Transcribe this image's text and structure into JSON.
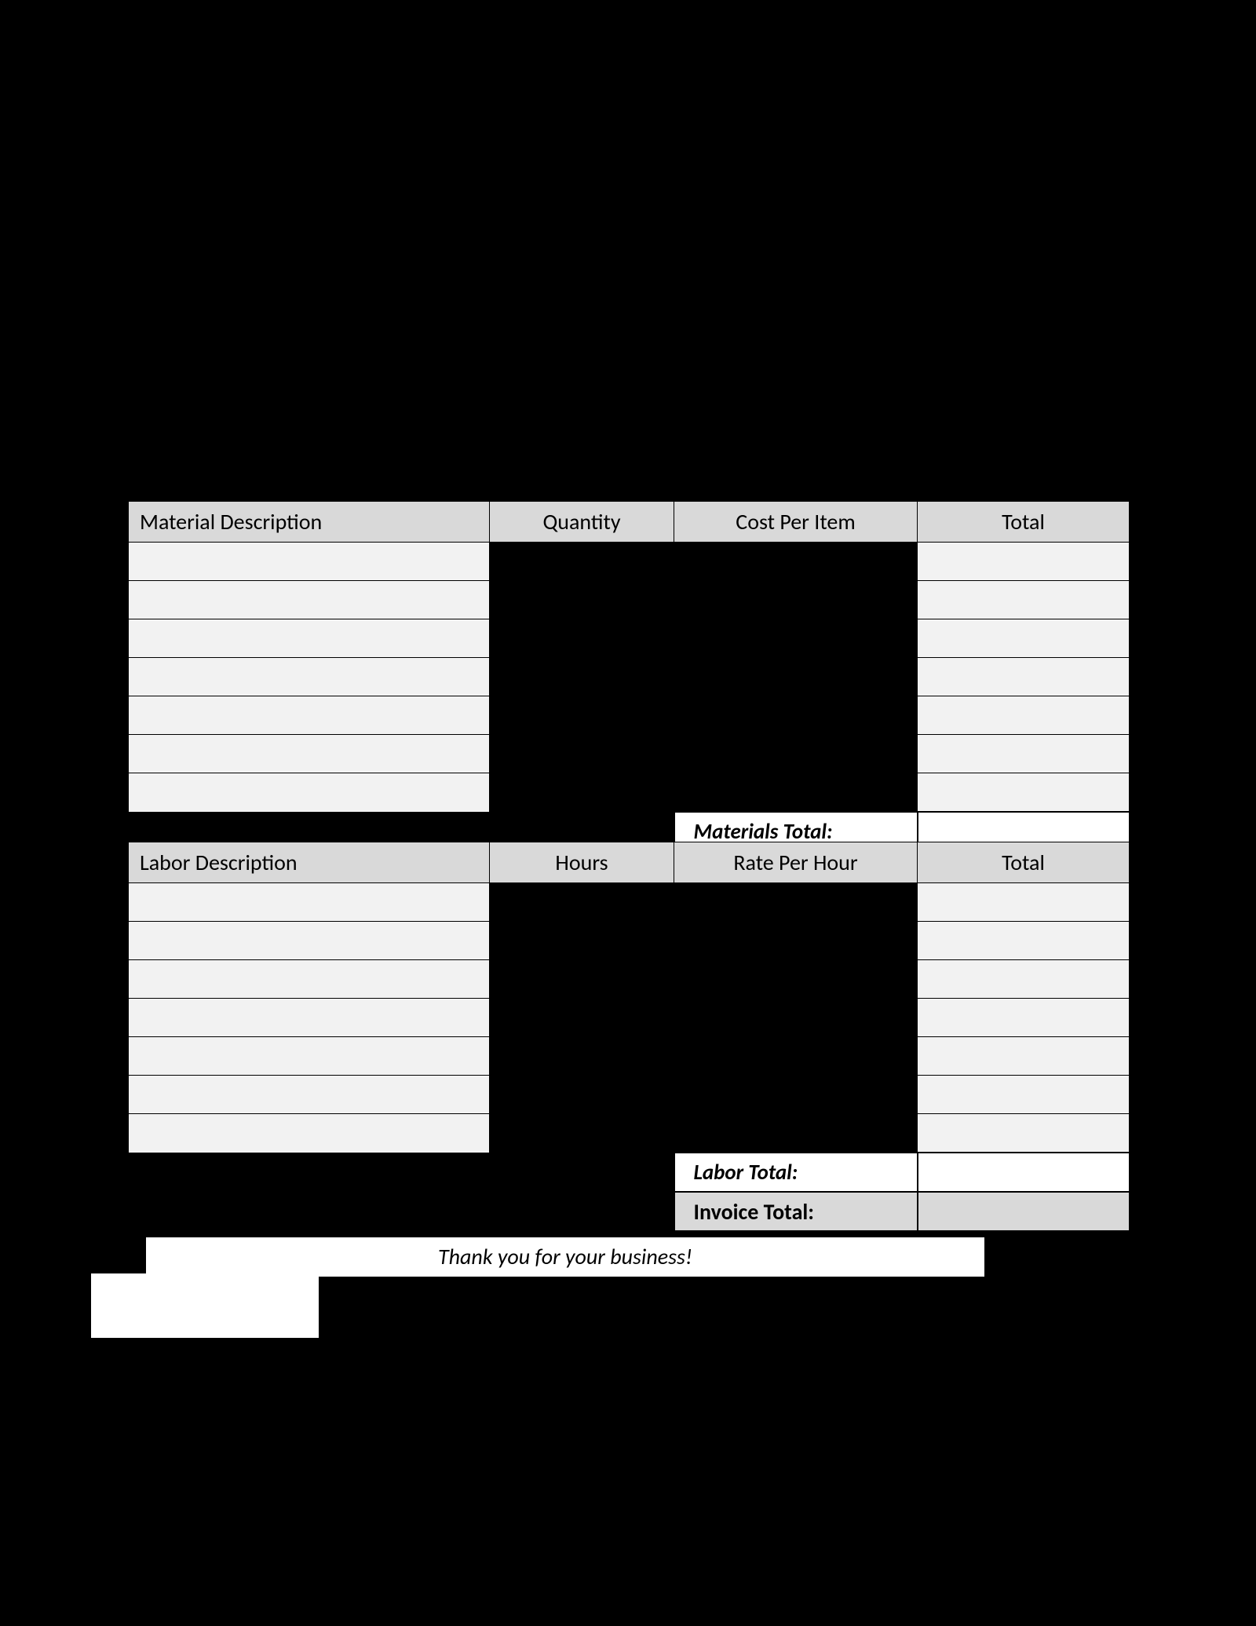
{
  "materials": {
    "headers": {
      "desc": "Material Description",
      "qty": "Quantity",
      "cost": "Cost Per Item",
      "total": "Total"
    },
    "rows": [
      {
        "desc": "",
        "qty": "",
        "cost": "",
        "total": ""
      },
      {
        "desc": "",
        "qty": "",
        "cost": "",
        "total": ""
      },
      {
        "desc": "",
        "qty": "",
        "cost": "",
        "total": ""
      },
      {
        "desc": "",
        "qty": "",
        "cost": "",
        "total": ""
      },
      {
        "desc": "",
        "qty": "",
        "cost": "",
        "total": ""
      },
      {
        "desc": "",
        "qty": "",
        "cost": "",
        "total": ""
      },
      {
        "desc": "",
        "qty": "",
        "cost": "",
        "total": ""
      }
    ],
    "total_label": "Materials Total:",
    "total_value": ""
  },
  "labor": {
    "headers": {
      "desc": "Labor Description",
      "hours": "Hours",
      "rate": "Rate Per Hour",
      "total": "Total"
    },
    "rows": [
      {
        "desc": "",
        "hours": "",
        "rate": "",
        "total": ""
      },
      {
        "desc": "",
        "hours": "",
        "rate": "",
        "total": ""
      },
      {
        "desc": "",
        "hours": "",
        "rate": "",
        "total": ""
      },
      {
        "desc": "",
        "hours": "",
        "rate": "",
        "total": ""
      },
      {
        "desc": "",
        "hours": "",
        "rate": "",
        "total": ""
      },
      {
        "desc": "",
        "hours": "",
        "rate": "",
        "total": ""
      },
      {
        "desc": "",
        "hours": "",
        "rate": "",
        "total": ""
      }
    ],
    "total_label": "Labor Total:",
    "total_value": ""
  },
  "invoice": {
    "total_label": "Invoice Total:",
    "total_value": ""
  },
  "footer": {
    "thank_you": "Thank you for your business!"
  }
}
